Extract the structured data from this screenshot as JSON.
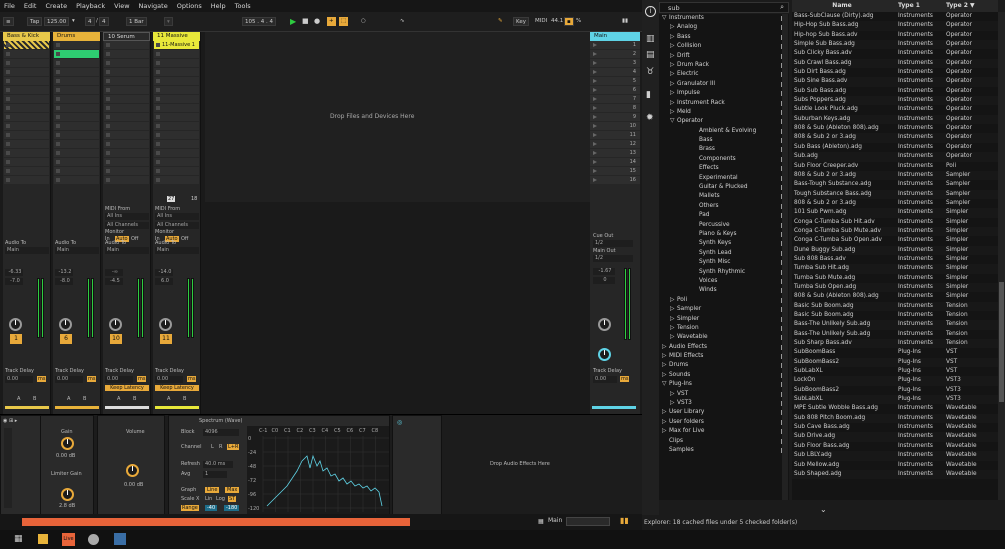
{
  "menu": [
    "File",
    "Edit",
    "Create",
    "Playback",
    "View",
    "Navigate",
    "Options",
    "Help",
    "Tools"
  ],
  "control": {
    "tap": "Tap",
    "tempo": "125.00",
    "sig_num": "4",
    "sig_den": "4",
    "quant": "1 Bar",
    "ext": "EXT",
    "pos": "105 .   4 .   4",
    "key": "Key",
    "midi": "MIDI",
    "cpu": "44.1",
    "pct": "%"
  },
  "tracks": [
    {
      "name": "Bass & Kick",
      "color": "#e8c84a",
      "vol": "-6.33",
      "pan": "-7.0",
      "num": "1",
      "delay": "0.00",
      "delay_unit": "ms",
      "audio_to": "Audio To",
      "out": "Main",
      "a": "A",
      "b": "B"
    },
    {
      "name": "Drums",
      "color": "#e8b33a",
      "vol": "-13.2",
      "pan": "-8.0",
      "num": "6",
      "delay": "0.00",
      "delay_unit": "ms",
      "audio_to": "Audio To",
      "out": "Main",
      "a": "A",
      "b": "B"
    },
    {
      "name": "10 Serum",
      "color": "#2a2a2a",
      "vol": "-∞",
      "pan": "-4.5",
      "num": "10",
      "delay": "0.00",
      "delay_unit": "ms",
      "audio_to": "Audio To",
      "out": "Main",
      "a": "A",
      "b": "B",
      "midi_from": "MIDI From",
      "all_ins": "All Ins",
      "all_ch": "All Channels",
      "monitor": "Monitor",
      "mon_in": "In",
      "mon_auto": "Auto",
      "mon_off": "Off",
      "keep": "Keep Latency"
    },
    {
      "name": "11 Massive",
      "color": "#e8e83a",
      "clip": "11-Massive 1",
      "vol": "-14.0",
      "pan": "6.0",
      "num": "11",
      "delay": "0.00",
      "delay_unit": "ms",
      "audio_to": "Audio To",
      "out": "Main",
      "a": "A",
      "b": "B",
      "midi_from": "MIDI From",
      "all_ins": "All Ins",
      "all_ch": "All Channels",
      "monitor": "Monitor",
      "mon_in": "In",
      "mon_auto": "Auto",
      "mon_off": "Off",
      "keep": "Keep Latency",
      "ctl1": "27",
      "ctl2": "18"
    }
  ],
  "drop_files": "Drop Files and Devices Here",
  "master": {
    "name": "Main",
    "scenes": [
      "1",
      "2",
      "3",
      "4",
      "5",
      "6",
      "7",
      "8",
      "9",
      "10",
      "11",
      "12",
      "13",
      "14",
      "15",
      "16"
    ],
    "cue_out": "Cue Out",
    "cue_val": "1/2",
    "main_out": "Main Out",
    "main_val": "1/2",
    "vol": "-1.67",
    "pan": "0",
    "delay_label": "Track Delay",
    "delay": "0.00",
    "delay_unit": "ms"
  },
  "devices": {
    "gain": "Gain",
    "gain_val": "0.00 dB",
    "limiter": "Limiter Gain",
    "lim_val": "2.8 dB",
    "volume": "Volume",
    "vol_val": "0.00 dB",
    "spectrum": "Spectrum (Wave)",
    "block": "Block",
    "block_val": "4096",
    "channel": "Channel",
    "ch_l": "L",
    "ch_r": "R",
    "ch_lr": "L+R",
    "refresh": "Refresh",
    "refresh_val": "40.0 ms",
    "avg": "Avg",
    "avg_val": "1",
    "graph": "Graph",
    "g_line": "Line",
    "g_max": "Max",
    "scalex": "Scale X",
    "s_lin": "Lin",
    "s_log": "Log",
    "s_st": "ST",
    "range": "Range",
    "r1": "-40",
    "r2": "-180",
    "drop_fx": "Drop Audio Effects Here",
    "notes": [
      "C-1",
      "C0",
      "C1",
      "C2",
      "C3",
      "C4",
      "C5",
      "C6",
      "C7",
      "C8"
    ],
    "dbs": [
      "0",
      "-24",
      "-48",
      "-72",
      "-96",
      "-120"
    ]
  },
  "status": {
    "main": "Main"
  },
  "browser": {
    "search": "sub",
    "tree": [
      {
        "t": "Instruments",
        "d": 0,
        "c": "▽"
      },
      {
        "t": "Analog",
        "d": 1,
        "c": "▷"
      },
      {
        "t": "Bass",
        "d": 1,
        "c": "▷"
      },
      {
        "t": "Collision",
        "d": 1,
        "c": "▷"
      },
      {
        "t": "Drift",
        "d": 1,
        "c": "▷"
      },
      {
        "t": "Drum Rack",
        "d": 1,
        "c": "▷"
      },
      {
        "t": "Electric",
        "d": 1,
        "c": "▷"
      },
      {
        "t": "Granulator III",
        "d": 1,
        "c": "▷"
      },
      {
        "t": "Impulse",
        "d": 1,
        "c": "▷"
      },
      {
        "t": "Instrument Rack",
        "d": 1,
        "c": "▷"
      },
      {
        "t": "Meld",
        "d": 1,
        "c": "▷"
      },
      {
        "t": "Operator",
        "d": 1,
        "c": "▽"
      },
      {
        "t": "Ambient & Evolving",
        "d": 2,
        "c": ""
      },
      {
        "t": "Bass",
        "d": 2,
        "c": ""
      },
      {
        "t": "Brass",
        "d": 2,
        "c": ""
      },
      {
        "t": "Components",
        "d": 2,
        "c": ""
      },
      {
        "t": "Effects",
        "d": 2,
        "c": ""
      },
      {
        "t": "Experimental",
        "d": 2,
        "c": ""
      },
      {
        "t": "Guitar & Plucked",
        "d": 2,
        "c": ""
      },
      {
        "t": "Mallets",
        "d": 2,
        "c": ""
      },
      {
        "t": "Others",
        "d": 2,
        "c": ""
      },
      {
        "t": "Pad",
        "d": 2,
        "c": ""
      },
      {
        "t": "Percussive",
        "d": 2,
        "c": ""
      },
      {
        "t": "Piano & Keys",
        "d": 2,
        "c": ""
      },
      {
        "t": "Synth Keys",
        "d": 2,
        "c": ""
      },
      {
        "t": "Synth Lead",
        "d": 2,
        "c": ""
      },
      {
        "t": "Synth Misc",
        "d": 2,
        "c": ""
      },
      {
        "t": "Synth Rhythmic",
        "d": 2,
        "c": ""
      },
      {
        "t": "Voices",
        "d": 2,
        "c": ""
      },
      {
        "t": "Winds",
        "d": 2,
        "c": ""
      },
      {
        "t": "Poli",
        "d": 1,
        "c": "▷"
      },
      {
        "t": "Sampler",
        "d": 1,
        "c": "▷"
      },
      {
        "t": "Simpler",
        "d": 1,
        "c": "▷"
      },
      {
        "t": "Tension",
        "d": 1,
        "c": "▷"
      },
      {
        "t": "Wavetable",
        "d": 1,
        "c": "▷"
      },
      {
        "t": "Audio Effects",
        "d": 0,
        "c": "▷"
      },
      {
        "t": "MIDI Effects",
        "d": 0,
        "c": "▷"
      },
      {
        "t": "Drums",
        "d": 0,
        "c": "▷"
      },
      {
        "t": "Sounds",
        "d": 0,
        "c": "▷"
      },
      {
        "t": "Plug-Ins",
        "d": 0,
        "c": "▽"
      },
      {
        "t": "VST",
        "d": 1,
        "c": "▷"
      },
      {
        "t": "VST3",
        "d": 1,
        "c": "▷"
      },
      {
        "t": "User Library",
        "d": 0,
        "c": "▷"
      },
      {
        "t": "User folders",
        "d": 0,
        "c": "▷"
      },
      {
        "t": "Max for Live",
        "d": 0,
        "c": "▷"
      },
      {
        "t": "Clips",
        "d": 0,
        "c": ""
      },
      {
        "t": "Samples",
        "d": 0,
        "c": ""
      }
    ],
    "headers": {
      "name": "Name",
      "type1": "Type 1",
      "type2": "Type 2 ▼"
    },
    "rows": [
      [
        "Bass-SubClause (Dirty).adg",
        "Instruments",
        "Operator"
      ],
      [
        "Hip-Hop Sub Bass.adg",
        "Instruments",
        "Operator"
      ],
      [
        "Hip-hop Sub Bass.adv",
        "Instruments",
        "Operator"
      ],
      [
        "Simple Sub Bass.adg",
        "Instruments",
        "Operator"
      ],
      [
        "Sub Clicky Bass.adv",
        "Instruments",
        "Operator"
      ],
      [
        "Sub Crawl Bass.adg",
        "Instruments",
        "Operator"
      ],
      [
        "Sub Dirt Bass.adg",
        "Instruments",
        "Operator"
      ],
      [
        "Sub Sine Bass.adv",
        "Instruments",
        "Operator"
      ],
      [
        "Sub Sub Bass.adg",
        "Instruments",
        "Operator"
      ],
      [
        "Subs Poppers.adg",
        "Instruments",
        "Operator"
      ],
      [
        "Subtle Look Pluck.adg",
        "Instruments",
        "Operator"
      ],
      [
        "Suburban Keys.adg",
        "Instruments",
        "Operator"
      ],
      [
        "808 & Sub (Ableton 808).adg",
        "Instruments",
        "Operator"
      ],
      [
        "808 & Sub 2 or 3.adg",
        "Instruments",
        "Operator"
      ],
      [
        "Sub Bass (Ableton).adg",
        "Instruments",
        "Operator"
      ],
      [
        "Sub.adg",
        "Instruments",
        "Operator"
      ],
      [
        "Sub Floor Creeper.adv",
        "Instruments",
        "Poli"
      ],
      [
        "808 & Sub 2 or 3.adg",
        "Instruments",
        "Sampler"
      ],
      [
        "Bass-Tough Substance.adg",
        "Instruments",
        "Sampler"
      ],
      [
        "Tough Substance Bass.adg",
        "Instruments",
        "Sampler"
      ],
      [
        "808 & Sub 2 or 3.adg",
        "Instruments",
        "Sampler"
      ],
      [
        "101 Sub Pwm.adg",
        "Instruments",
        "Simpler"
      ],
      [
        "Conga C-Tumba Sub Hit.adv",
        "Instruments",
        "Simpler"
      ],
      [
        "Conga C-Tumba Sub Mute.adv",
        "Instruments",
        "Simpler"
      ],
      [
        "Conga C-Tumba Sub Open.adv",
        "Instruments",
        "Simpler"
      ],
      [
        "Dune Buggy Sub.adg",
        "Instruments",
        "Simpler"
      ],
      [
        "Sub 808 Bass.adv",
        "Instruments",
        "Simpler"
      ],
      [
        "Tumba Sub Hit.adg",
        "Instruments",
        "Simpler"
      ],
      [
        "Tumba Sub Mute.adg",
        "Instruments",
        "Simpler"
      ],
      [
        "Tumba Sub Open.adg",
        "Instruments",
        "Simpler"
      ],
      [
        "808 & Sub (Ableton 808).adg",
        "Instruments",
        "Simpler"
      ],
      [
        "Basic Sub Boom.adg",
        "Instruments",
        "Tension"
      ],
      [
        "Basic Sub Boom.adg",
        "Instruments",
        "Tension"
      ],
      [
        "Bass-The Unlikely Sub.adg",
        "Instruments",
        "Tension"
      ],
      [
        "Bass-The Unlikely Sub.adg",
        "Instruments",
        "Tension"
      ],
      [
        "Sub Sharp Bass.adv",
        "Instruments",
        "Tension"
      ],
      [
        "SubBoomBass",
        "Plug-Ins",
        "VST"
      ],
      [
        "SubBoomBass2",
        "Plug-Ins",
        "VST"
      ],
      [
        "SubLabXL",
        "Plug-Ins",
        "VST"
      ],
      [
        "LockOn",
        "Plug-Ins",
        "VST3"
      ],
      [
        "SubBoomBass2",
        "Plug-Ins",
        "VST3"
      ],
      [
        "SubLabXL",
        "Plug-Ins",
        "VST3"
      ],
      [
        "MPE Subtle Wobble Bass.adg",
        "Instruments",
        "Wavetable"
      ],
      [
        "Sub 808 Pitch Boom.adg",
        "Instruments",
        "Wavetable"
      ],
      [
        "Sub Cave Bass.adg",
        "Instruments",
        "Wavetable"
      ],
      [
        "Sub Drive.adg",
        "Instruments",
        "Wavetable"
      ],
      [
        "Sub Floor Bass.adg",
        "Instruments",
        "Wavetable"
      ],
      [
        "Sub LBLY.adg",
        "Instruments",
        "Wavetable"
      ],
      [
        "Sub Mellow.adg",
        "Instruments",
        "Wavetable"
      ],
      [
        "Sub Shaped.adg",
        "Instruments",
        "Wavetable"
      ]
    ],
    "status": "Explorer: 18 cached files under 5 checked folder(s)"
  }
}
